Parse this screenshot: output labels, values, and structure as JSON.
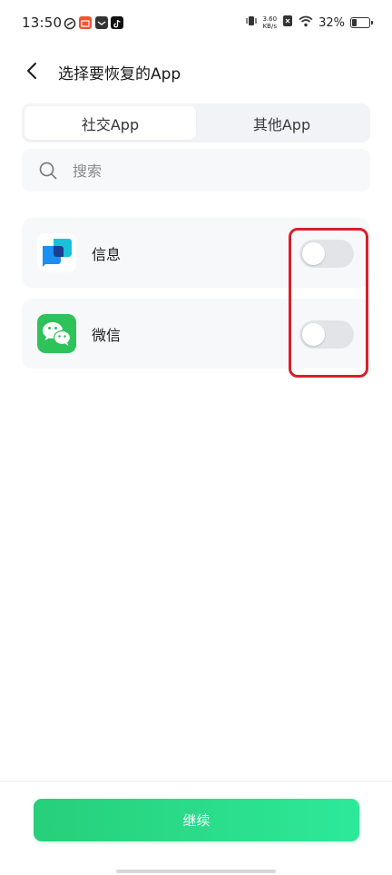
{
  "status_bar": {
    "time": "13:50",
    "network_speed_value": "3.60",
    "network_speed_unit": "KB/s",
    "battery_percent": "32%",
    "battery_level": 0.32
  },
  "header": {
    "title": "选择要恢复的App"
  },
  "tabs": [
    {
      "label": "社交App",
      "active": true
    },
    {
      "label": "其他App",
      "active": false
    }
  ],
  "search": {
    "placeholder": "搜索",
    "value": ""
  },
  "apps": [
    {
      "name": "信息",
      "icon": "messages-icon",
      "enabled": false
    },
    {
      "name": "微信",
      "icon": "wechat-icon",
      "enabled": false
    }
  ],
  "footer": {
    "continue_label": "继续"
  },
  "colors": {
    "accent": "#2de99a",
    "highlight": "#d8202a",
    "wechat": "#2ec25b",
    "messages": "#1ea7f0"
  }
}
